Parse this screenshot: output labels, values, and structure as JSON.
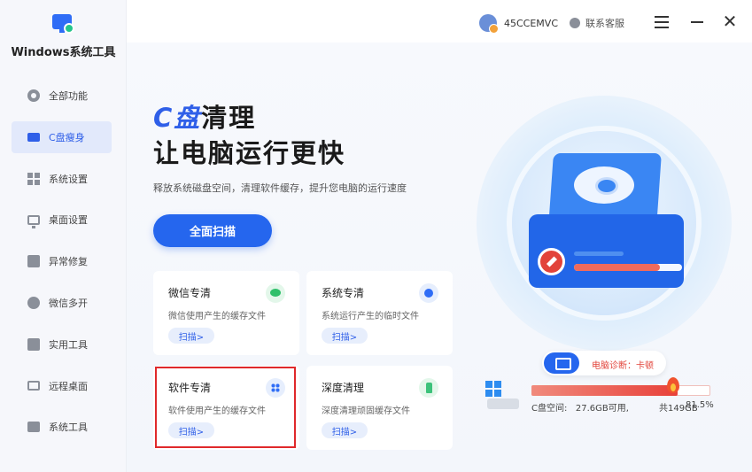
{
  "app": {
    "name": "Windows系统工具"
  },
  "sidebar": {
    "items": [
      {
        "label": "全部功能",
        "icon": "gear-icon"
      },
      {
        "label": "C盘瘦身",
        "icon": "disk-icon",
        "active": true
      },
      {
        "label": "系统设置",
        "icon": "grid-icon"
      },
      {
        "label": "桌面设置",
        "icon": "monitor-icon"
      },
      {
        "label": "异常修复",
        "icon": "tool-icon"
      },
      {
        "label": "微信多开",
        "icon": "chat-icon"
      },
      {
        "label": "实用工具",
        "icon": "box-icon"
      },
      {
        "label": "远程桌面",
        "icon": "remote-icon"
      },
      {
        "label": "系统工具",
        "icon": "toolbox-icon"
      }
    ]
  },
  "topbar": {
    "user": "45CCEMVC",
    "service": "联系客服"
  },
  "hero": {
    "title_accent": "C盘",
    "title_rest": "清理",
    "subtitle": "让电脑运行更快",
    "description": "释放系统磁盘空间，清理软件缓存，提升您电脑的运行速度",
    "scan_all": "全面扫描"
  },
  "cards": [
    {
      "title": "微信专清",
      "desc": "微信使用产生的缓存文件",
      "button": "扫描>",
      "icon": "wechat-icon"
    },
    {
      "title": "系统专清",
      "desc": "系统运行产生的临时文件",
      "button": "扫描>",
      "icon": "system-gear-icon"
    },
    {
      "title": "软件专清",
      "desc": "软件使用产生的缓存文件",
      "button": "扫描>",
      "icon": "apps-icon"
    },
    {
      "title": "深度清理",
      "desc": "深度清理顽固缓存文件",
      "button": "扫描>",
      "icon": "broom-icon"
    }
  ],
  "diagnosis": {
    "text": "电脑诊断：卡顿"
  },
  "disk": {
    "label": "C盘空间:",
    "free": "27.6GB可用,",
    "total": "共149GB",
    "percent": "81.5%",
    "usage": 0.815
  },
  "colors": {
    "accent": "#2566ee",
    "alert": "#e2433a",
    "highlight": "#e0292b"
  }
}
